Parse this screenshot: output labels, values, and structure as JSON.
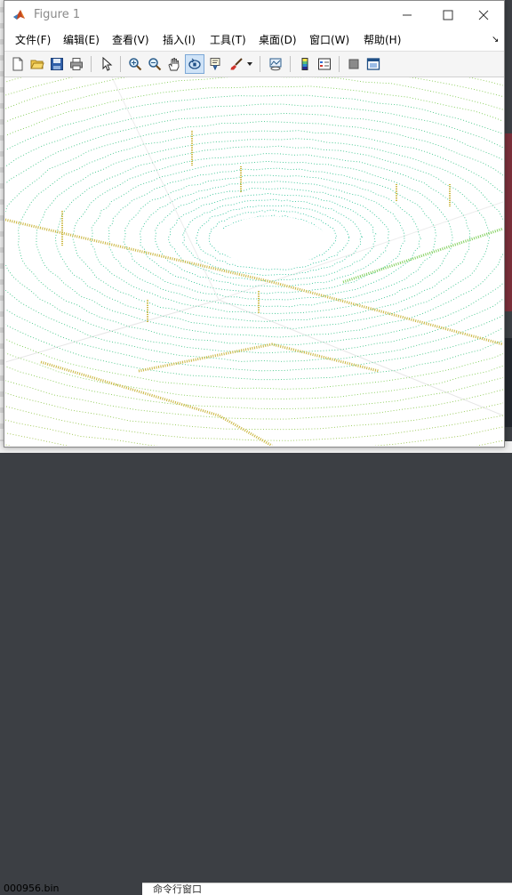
{
  "window": {
    "title": "Figure 1",
    "controls": {
      "minimize": "minimize",
      "maximize": "maximize",
      "close": "close"
    }
  },
  "menu": {
    "items": [
      "文件(F)",
      "编辑(E)",
      "查看(V)",
      "插入(I)",
      "工具(T)",
      "桌面(D)",
      "窗口(W)",
      "帮助(H)"
    ]
  },
  "toolbar": {
    "buttons": [
      {
        "name": "new-figure",
        "icon": "new-file-icon"
      },
      {
        "name": "open-file",
        "icon": "folder-open-icon"
      },
      {
        "name": "save-figure",
        "icon": "save-icon"
      },
      {
        "name": "print-figure",
        "icon": "print-icon"
      },
      {
        "name": "edit-plot",
        "icon": "cursor-arrow-icon"
      },
      {
        "name": "zoom-in",
        "icon": "zoom-in-icon"
      },
      {
        "name": "zoom-out",
        "icon": "zoom-out-icon"
      },
      {
        "name": "pan",
        "icon": "hand-icon"
      },
      {
        "name": "rotate-3d",
        "icon": "rotate-3d-icon",
        "active": true
      },
      {
        "name": "data-cursor",
        "icon": "data-cursor-icon"
      },
      {
        "name": "brush",
        "icon": "brush-icon"
      },
      {
        "name": "link-plot",
        "icon": "link-plot-icon"
      },
      {
        "name": "insert-colorbar",
        "icon": "colorbar-icon"
      },
      {
        "name": "insert-legend",
        "icon": "legend-icon"
      },
      {
        "name": "hide-plot-tools",
        "icon": "hide-tools-icon"
      },
      {
        "name": "show-plot-tools",
        "icon": "show-tools-icon"
      }
    ]
  },
  "plot": {
    "type": "3d-point-cloud",
    "colors": {
      "low": "#2ec4a0",
      "mid": "#7fcf5a",
      "high": "#c9b43a"
    }
  },
  "background": {
    "file_label": "000956.bin",
    "panel_label": "命令行窗口"
  }
}
